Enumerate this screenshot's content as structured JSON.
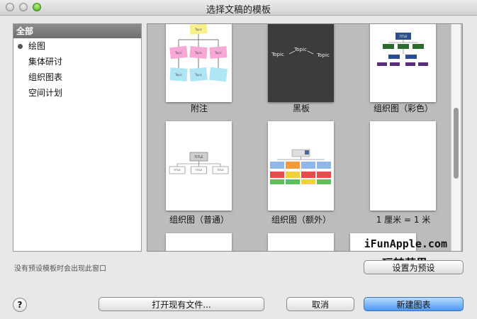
{
  "window": {
    "title": "选择文稿的模板"
  },
  "sidebar": {
    "header": "全部",
    "items": [
      {
        "label": "绘图"
      },
      {
        "label": "集体研讨"
      },
      {
        "label": "组织图表"
      },
      {
        "label": "空间计划"
      }
    ]
  },
  "hint": "没有预设模板时会出现此窗口",
  "gallery": {
    "templates": [
      {
        "caption": "附注",
        "thumb_text": [
          "Topic",
          "Topic",
          "Topic",
          "Topic",
          "Topic",
          "Topic"
        ]
      },
      {
        "caption": "黑板",
        "thumb_text": [
          "Topic",
          "Topic",
          "Topic"
        ]
      },
      {
        "caption": "组织图（彩色）",
        "thumb_text": [
          "TITLE"
        ]
      },
      {
        "caption": "组织图（普通）",
        "thumb_text": [
          "TITLE",
          "TITLE",
          "TITLE",
          "TITLE"
        ]
      },
      {
        "caption": "组织图（额外）",
        "thumb_text": []
      },
      {
        "caption": "1 厘米 = 1 米",
        "thumb_text": []
      }
    ]
  },
  "watermark": {
    "line1": "iFunApple.com",
    "line2": "玩转苹果"
  },
  "buttons": {
    "set_default": "设置为预设",
    "open_existing": "打开现有文件...",
    "cancel": "取消",
    "new_chart": "新建图表",
    "help": "?"
  }
}
